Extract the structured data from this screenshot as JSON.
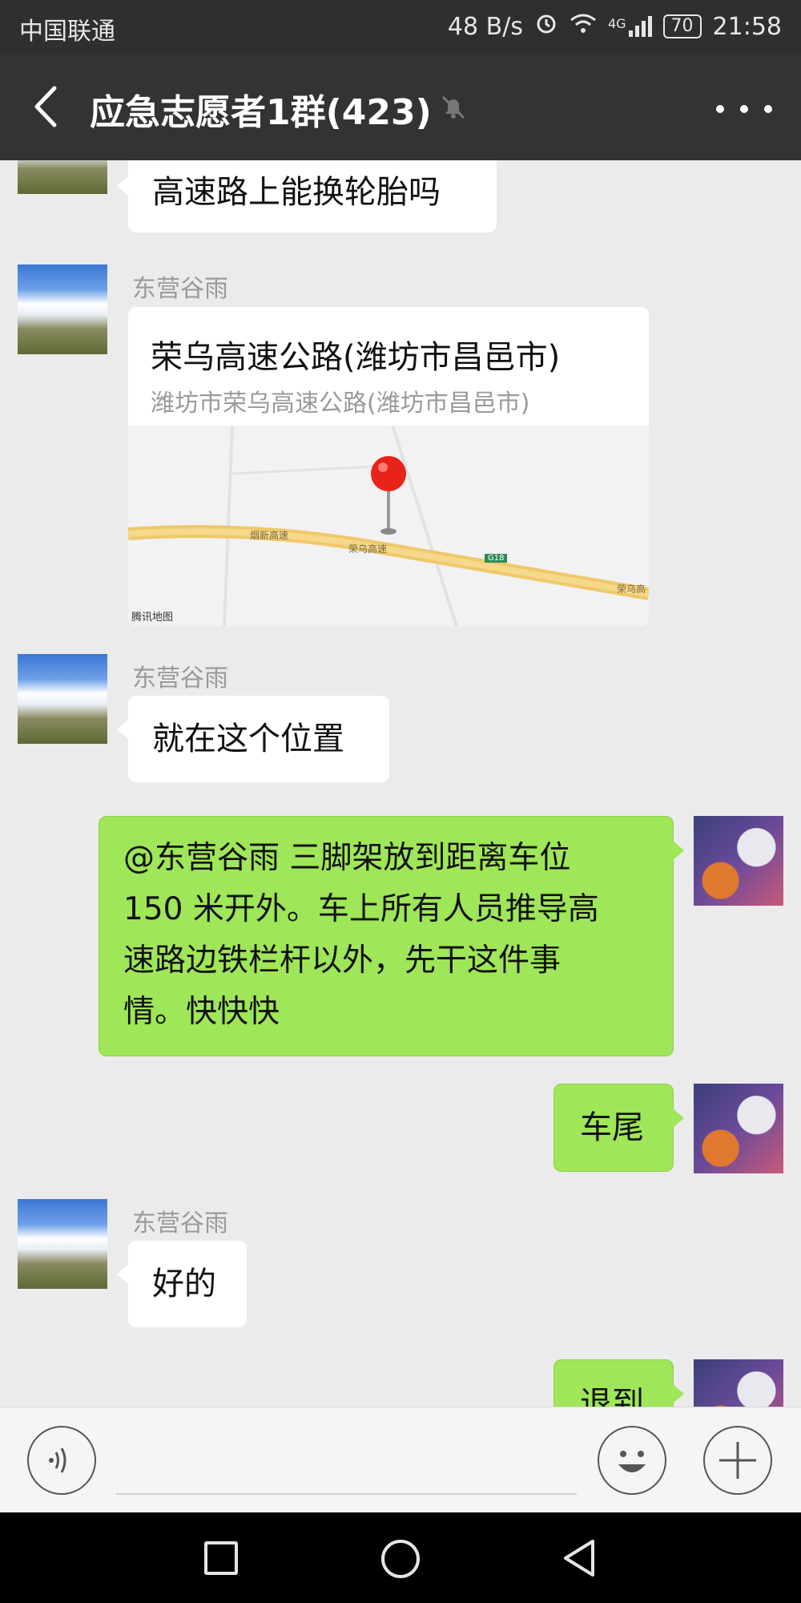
{
  "status_bar": {
    "carrier": "中国联通",
    "net_speed": "48 B/s",
    "signal": "4G",
    "battery": "70",
    "time": "21:58"
  },
  "header": {
    "title": "应急志愿者1群(423)",
    "icons": [
      "back-icon",
      "mute-bell-icon",
      "more-icon"
    ]
  },
  "messages": [
    {
      "side": "left",
      "sender": "",
      "text": "高速路上能换轮胎吗"
    },
    {
      "side": "left",
      "sender": "东营谷雨",
      "type": "location",
      "title": "荣乌高速公路(潍坊市昌邑市)",
      "subtitle": "潍坊市荣乌高速公路(潍坊市昌邑市)",
      "map_labels": [
        "烟新高速",
        "荣乌高速",
        "G18",
        "荣乌高",
        "腾讯地图"
      ]
    },
    {
      "side": "left",
      "sender": "东营谷雨",
      "text": "就在这个位置"
    },
    {
      "side": "right",
      "lines": [
        "@东营谷雨  三脚架放到距离车位",
        "150 米开外。车上所有人员推导高",
        "速路边铁栏杆以外，先干这件事",
        "情。快快快"
      ]
    },
    {
      "side": "right",
      "text": "车尾"
    },
    {
      "side": "left",
      "sender": "东营谷雨",
      "text": "好的"
    },
    {
      "side": "right",
      "text": "退到"
    }
  ],
  "composer": {
    "icons": [
      "voice-icon",
      "emoji-icon",
      "plus-icon"
    ]
  },
  "nav_bar": {
    "icons": [
      "recent-apps-icon",
      "home-icon",
      "back-nav-icon"
    ]
  }
}
